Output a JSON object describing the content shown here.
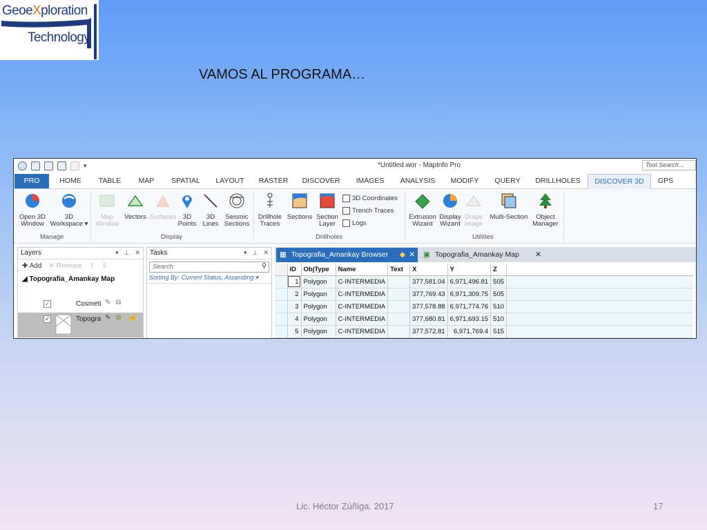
{
  "logo": {
    "line1_a": "Geoe",
    "line1_x": "X",
    "line1_b": "ploration",
    "line2": "Technology"
  },
  "slide_title": "VAMOS AL PROGRAMA…",
  "footer": {
    "author": "Lic. Héctor Zúñiga. 2017",
    "page": "17"
  },
  "window": {
    "title": "*Untitled.wor - MapInfo Pro",
    "tool_search": "Tool Search..."
  },
  "tabs": [
    {
      "label": "PRO"
    },
    {
      "label": "HOME"
    },
    {
      "label": "TABLE"
    },
    {
      "label": "MAP"
    },
    {
      "label": "SPATIAL"
    },
    {
      "label": "LAYOUT"
    },
    {
      "label": "RASTER"
    },
    {
      "label": "DISCOVER"
    },
    {
      "label": "IMAGES"
    },
    {
      "label": "ANALYSIS"
    },
    {
      "label": "MODIFY"
    },
    {
      "label": "QUERY"
    },
    {
      "label": "DRILLHOLES"
    },
    {
      "label": "DISCOVER 3D"
    },
    {
      "label": "GPS"
    }
  ],
  "ribbon": {
    "open3d": "Open 3D\nWindow",
    "workspace": "3D\nWorkspace ▾",
    "manage": "Manage",
    "map_window": "Map\nWindow",
    "vectors": "Vectors",
    "surfaces": "Surfaces",
    "points3d": "3D\nPoints",
    "lines3d": "3D\nLines",
    "seismic": "Seismic\nSections",
    "display": "Display",
    "drillhole_traces": "Drillhole\nTraces",
    "sections": "Sections",
    "section_layer": "Section\nLayer",
    "coords3d": "3D Coordinates",
    "trench": "Trench Traces",
    "logs": "Logs",
    "drillholes": "Drillholes",
    "extrusion": "Extrusion\nWizard",
    "display_wizard": "Display\nWizard",
    "drape": "Drape\nImage",
    "multisection": "Multi-Section",
    "object_manager": "Object\nManager",
    "utilities": "Utilities"
  },
  "layers": {
    "title": "Layers",
    "add": "Add",
    "remove": "Remove",
    "map_name": "Topografia_Amankay Map",
    "items": [
      {
        "label": "Cosmeti"
      },
      {
        "label": "Topogra"
      }
    ]
  },
  "tasks": {
    "title": "Tasks",
    "search_placeholder": "Search",
    "sorting": "Sorting By: Current Status, Ascending"
  },
  "doc_tabs": {
    "browser": "Topografia_Amankay Browser",
    "map": "Topografia_Amankay Map"
  },
  "browser": {
    "columns": [
      "ID",
      "ObjType",
      "Name",
      "Text",
      "X",
      "Y",
      "Z"
    ],
    "rows": [
      [
        "1",
        "Polygon",
        "C-INTERMEDIA",
        "",
        "377,581.04",
        "6,971,496.81",
        "505"
      ],
      [
        "2",
        "Polygon",
        "C-INTERMEDIA",
        "",
        "377,769.43",
        "6,971,309.75",
        "505"
      ],
      [
        "3",
        "Polygon",
        "C-INTERMEDIA",
        "",
        "377,578.88",
        "6,971,774.76",
        "510"
      ],
      [
        "4",
        "Polygon",
        "C-INTERMEDIA",
        "",
        "377,680.81",
        "6,971,693.15",
        "510"
      ],
      [
        "5",
        "Polygon",
        "C-INTERMEDIA",
        "",
        "377,572.81",
        "6,971,769.4",
        "515"
      ]
    ]
  },
  "colors": {
    "accent": "#2a6ebb",
    "background_top": "#5f9cf7",
    "background_bottom": "#f3e4f3"
  }
}
